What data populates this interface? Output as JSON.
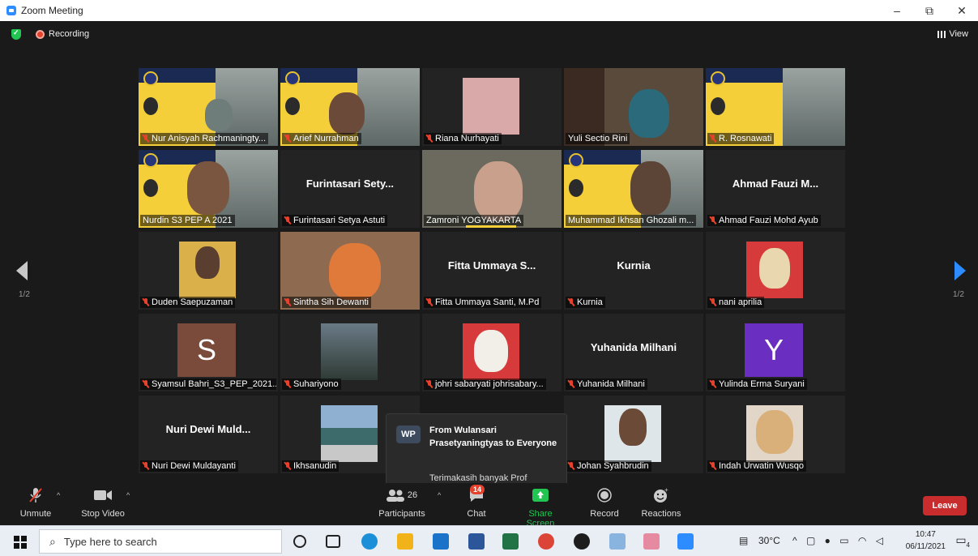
{
  "window": {
    "title": "Zoom Meeting",
    "minimize": "–",
    "restore": "⧉",
    "close": "✕"
  },
  "meeting": {
    "recording_label": "Recording",
    "view_label": "View"
  },
  "navigation": {
    "prev_page": "1/2",
    "next_page": "1/2"
  },
  "participants": [
    {
      "name": "Nur Anisyah Rachmaningty...",
      "muted": true,
      "video": "slide",
      "speaking": true
    },
    {
      "name": "Arief Nurrahman",
      "muted": true,
      "video": "slide"
    },
    {
      "name": "Riana Nurhayati",
      "muted": true,
      "video": "photo"
    },
    {
      "name": "Yuli Sectio Rini",
      "muted": false,
      "video": "camera"
    },
    {
      "name": "R. Rosnawati",
      "muted": true,
      "video": "slide"
    },
    {
      "name": "Nurdin S3 PEP A 2021",
      "muted": false,
      "video": "slide"
    },
    {
      "name": "Furintasari Setya Astuti",
      "display": "Furintasari Sety...",
      "muted": true,
      "video": "none"
    },
    {
      "name": "Zamroni YOGYAKARTA",
      "muted": false,
      "video": "camera"
    },
    {
      "name": "Muhammad Ikhsan Ghozali m...",
      "muted": false,
      "video": "slide"
    },
    {
      "name": "Ahmad Fauzi Mohd Ayub",
      "display": "Ahmad Fauzi M...",
      "muted": true,
      "video": "none"
    },
    {
      "name": "Duden Saepuzaman",
      "muted": true,
      "video": "photo"
    },
    {
      "name": "Sintha Sih Dewanti",
      "muted": true,
      "video": "camera"
    },
    {
      "name": "Fitta Ummaya Santi, M.Pd",
      "display": "Fitta Ummaya S...",
      "muted": true,
      "video": "none"
    },
    {
      "name": "Kurnia",
      "display": "Kurnia",
      "muted": true,
      "video": "none"
    },
    {
      "name": "nani aprilia",
      "muted": true,
      "video": "photo"
    },
    {
      "name": "Syamsul Bahri_S3_PEP_2021...",
      "initial": "S",
      "avatar_color": "#7a4a3a",
      "muted": true,
      "video": "avatar"
    },
    {
      "name": "Suhariyono",
      "muted": true,
      "video": "photo"
    },
    {
      "name": "johri sabaryati johrisabary...",
      "muted": true,
      "video": "photo"
    },
    {
      "name": "Yuhanida Milhani",
      "display": "Yuhanida Milhani",
      "muted": true,
      "video": "none"
    },
    {
      "name": "Yulinda Erma Suryani",
      "initial": "Y",
      "avatar_color": "#6a2fc0",
      "muted": true,
      "video": "avatar"
    },
    {
      "name": "Nuri Dewi Muldayanti",
      "display": "Nuri Dewi Muld...",
      "muted": true,
      "video": "none"
    },
    {
      "name": "Ikhsanudin",
      "muted": true,
      "video": "photo"
    },
    {
      "name": "Johan Syahbrudin",
      "muted": true,
      "video": "photo"
    },
    {
      "name": "Indah Urwatin Wusqo",
      "muted": true,
      "video": "photo"
    }
  ],
  "chat_popup": {
    "avatar": "WP",
    "from": "From Wulansari Prasetyaningtyas to Everyone",
    "message": "Terimakasih banyak Prof"
  },
  "toolbar": {
    "unmute": "Unmute",
    "stop_video": "Stop Video",
    "participants": "Participants",
    "participants_count": "26",
    "chat": "Chat",
    "chat_badge": "14",
    "share_screen": "Share Screen",
    "record": "Record",
    "reactions": "Reactions",
    "leave": "Leave"
  },
  "taskbar": {
    "search_placeholder": "Type here to search",
    "temperature": "30°C",
    "time": "10:47",
    "date": "06/11/2021",
    "notifications": "4"
  },
  "colors": {
    "speaking_border": "#c6e84a",
    "leave": "#c92c2c",
    "share": "#23c552",
    "badge": "#e8412b",
    "accent": "#2d8cff"
  }
}
